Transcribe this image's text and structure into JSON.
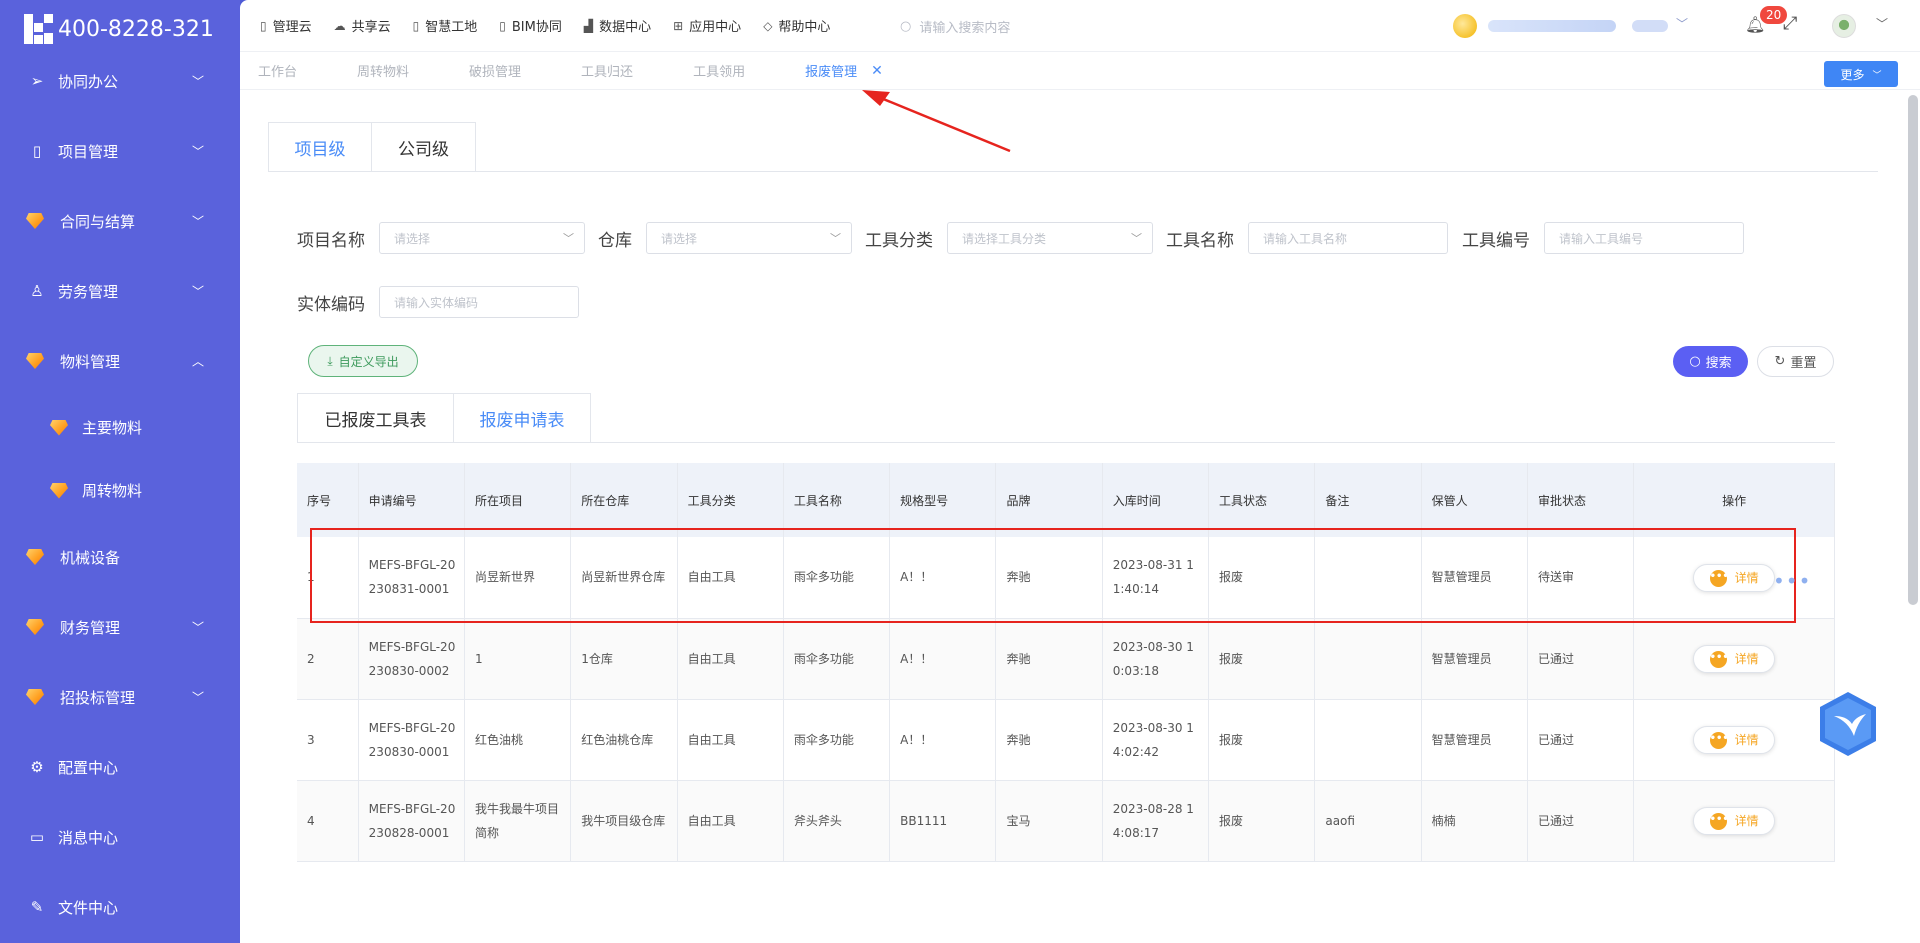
{
  "brand": {
    "phone": "400-8228-321"
  },
  "sidebar": {
    "items": [
      {
        "label": "协同办公",
        "icon": "send-icon",
        "chev": "down"
      },
      {
        "label": "项目管理",
        "icon": "book-icon",
        "chev": "down"
      },
      {
        "label": "合同与结算",
        "icon": "gem-icon",
        "chev": "down"
      },
      {
        "label": "劳务管理",
        "icon": "user-icon",
        "chev": "down"
      },
      {
        "label": "物料管理",
        "icon": "gem-icon",
        "chev": "up"
      },
      {
        "label": "机械设备",
        "icon": "gem-icon"
      },
      {
        "label": "财务管理",
        "icon": "gem-icon",
        "chev": "down"
      },
      {
        "label": "招投标管理",
        "icon": "gem-icon",
        "chev": "down"
      },
      {
        "label": "配置中心",
        "icon": "gear-icon"
      },
      {
        "label": "消息中心",
        "icon": "chat-icon"
      },
      {
        "label": "文件中心",
        "icon": "edit-icon"
      }
    ],
    "subitems": [
      {
        "label": "主要物料"
      },
      {
        "label": "周转物料"
      }
    ]
  },
  "topnav": {
    "items": [
      {
        "label": "管理云",
        "icon": "doc-icon"
      },
      {
        "label": "共享云",
        "icon": "cloud-icon"
      },
      {
        "label": "智慧工地",
        "icon": "doc-icon"
      },
      {
        "label": "BIM协同",
        "icon": "doc-icon"
      },
      {
        "label": "数据中心",
        "icon": "chart-icon"
      },
      {
        "label": "应用中心",
        "icon": "grid-icon"
      },
      {
        "label": "帮助中心",
        "icon": "help-icon"
      }
    ],
    "search_placeholder": "请输入搜索内容",
    "notification_count": "20"
  },
  "tabbar": {
    "tabs": [
      "工作台",
      "周转物料",
      "破损管理",
      "工具归还",
      "工具领用",
      "报废管理"
    ],
    "active": "报废管理",
    "more_label": "更多"
  },
  "level_tabs": [
    "项目级",
    "公司级"
  ],
  "filters": {
    "project_label": "项目名称",
    "project_placeholder": "请选择",
    "warehouse_label": "仓库",
    "warehouse_placeholder": "请选择",
    "category_label": "工具分类",
    "category_placeholder": "请选择工具分类",
    "toolname_label": "工具名称",
    "toolname_placeholder": "请输入工具名称",
    "toolno_label": "工具编号",
    "toolno_placeholder": "请输入工具编号",
    "entity_label": "实体编码",
    "entity_placeholder": "请输入实体编码"
  },
  "buttons": {
    "export": "自定义导出",
    "search": "搜索",
    "reset": "重置",
    "detail": "详情"
  },
  "sub_tabs": [
    "已报废工具表",
    "报废申请表"
  ],
  "table": {
    "headers": [
      "序号",
      "申请编号",
      "所在项目",
      "所在仓库",
      "工具分类",
      "工具名称",
      "规格型号",
      "品牌",
      "入库时间",
      "工具状态",
      "备注",
      "保管人",
      "审批状态",
      "操作"
    ],
    "rows": [
      [
        "1",
        "MEFS-BFGL-20\n230831-0001",
        "尚昱新世界",
        "尚昱新世界仓库",
        "自由工具",
        "雨伞多功能",
        "A！！",
        "奔驰",
        "2023-08-31 1\n1:40:14",
        "报废",
        "",
        "智慧管理员",
        "待送审"
      ],
      [
        "2",
        "MEFS-BFGL-20\n230830-0002",
        "1",
        "1仓库",
        "自由工具",
        "雨伞多功能",
        "A！！",
        "奔驰",
        "2023-08-30 1\n0:03:18",
        "报废",
        "",
        "智慧管理员",
        "已通过"
      ],
      [
        "3",
        "MEFS-BFGL-20\n230830-0001",
        "红色油桃",
        "红色油桃仓库",
        "自由工具",
        "雨伞多功能",
        "A！！",
        "奔驰",
        "2023-08-30 1\n4:02:42",
        "报废",
        "",
        "智慧管理员",
        "已通过"
      ],
      [
        "4",
        "MEFS-BFGL-20\n230828-0001",
        "我牛我最牛项目\n简称",
        "我牛项目级仓库",
        "自由工具",
        "斧头斧头",
        "BB1111",
        "宝马",
        "2023-08-28 1\n4:08:17",
        "报废",
        "aaofi",
        "楠楠",
        "已通过"
      ]
    ]
  },
  "colors": {
    "sidebar": "#5a62dc",
    "accent": "#4a8cf7",
    "search_btn": "#5b5ff3",
    "highlight": "#e6241e",
    "detail": "#f5a623"
  }
}
